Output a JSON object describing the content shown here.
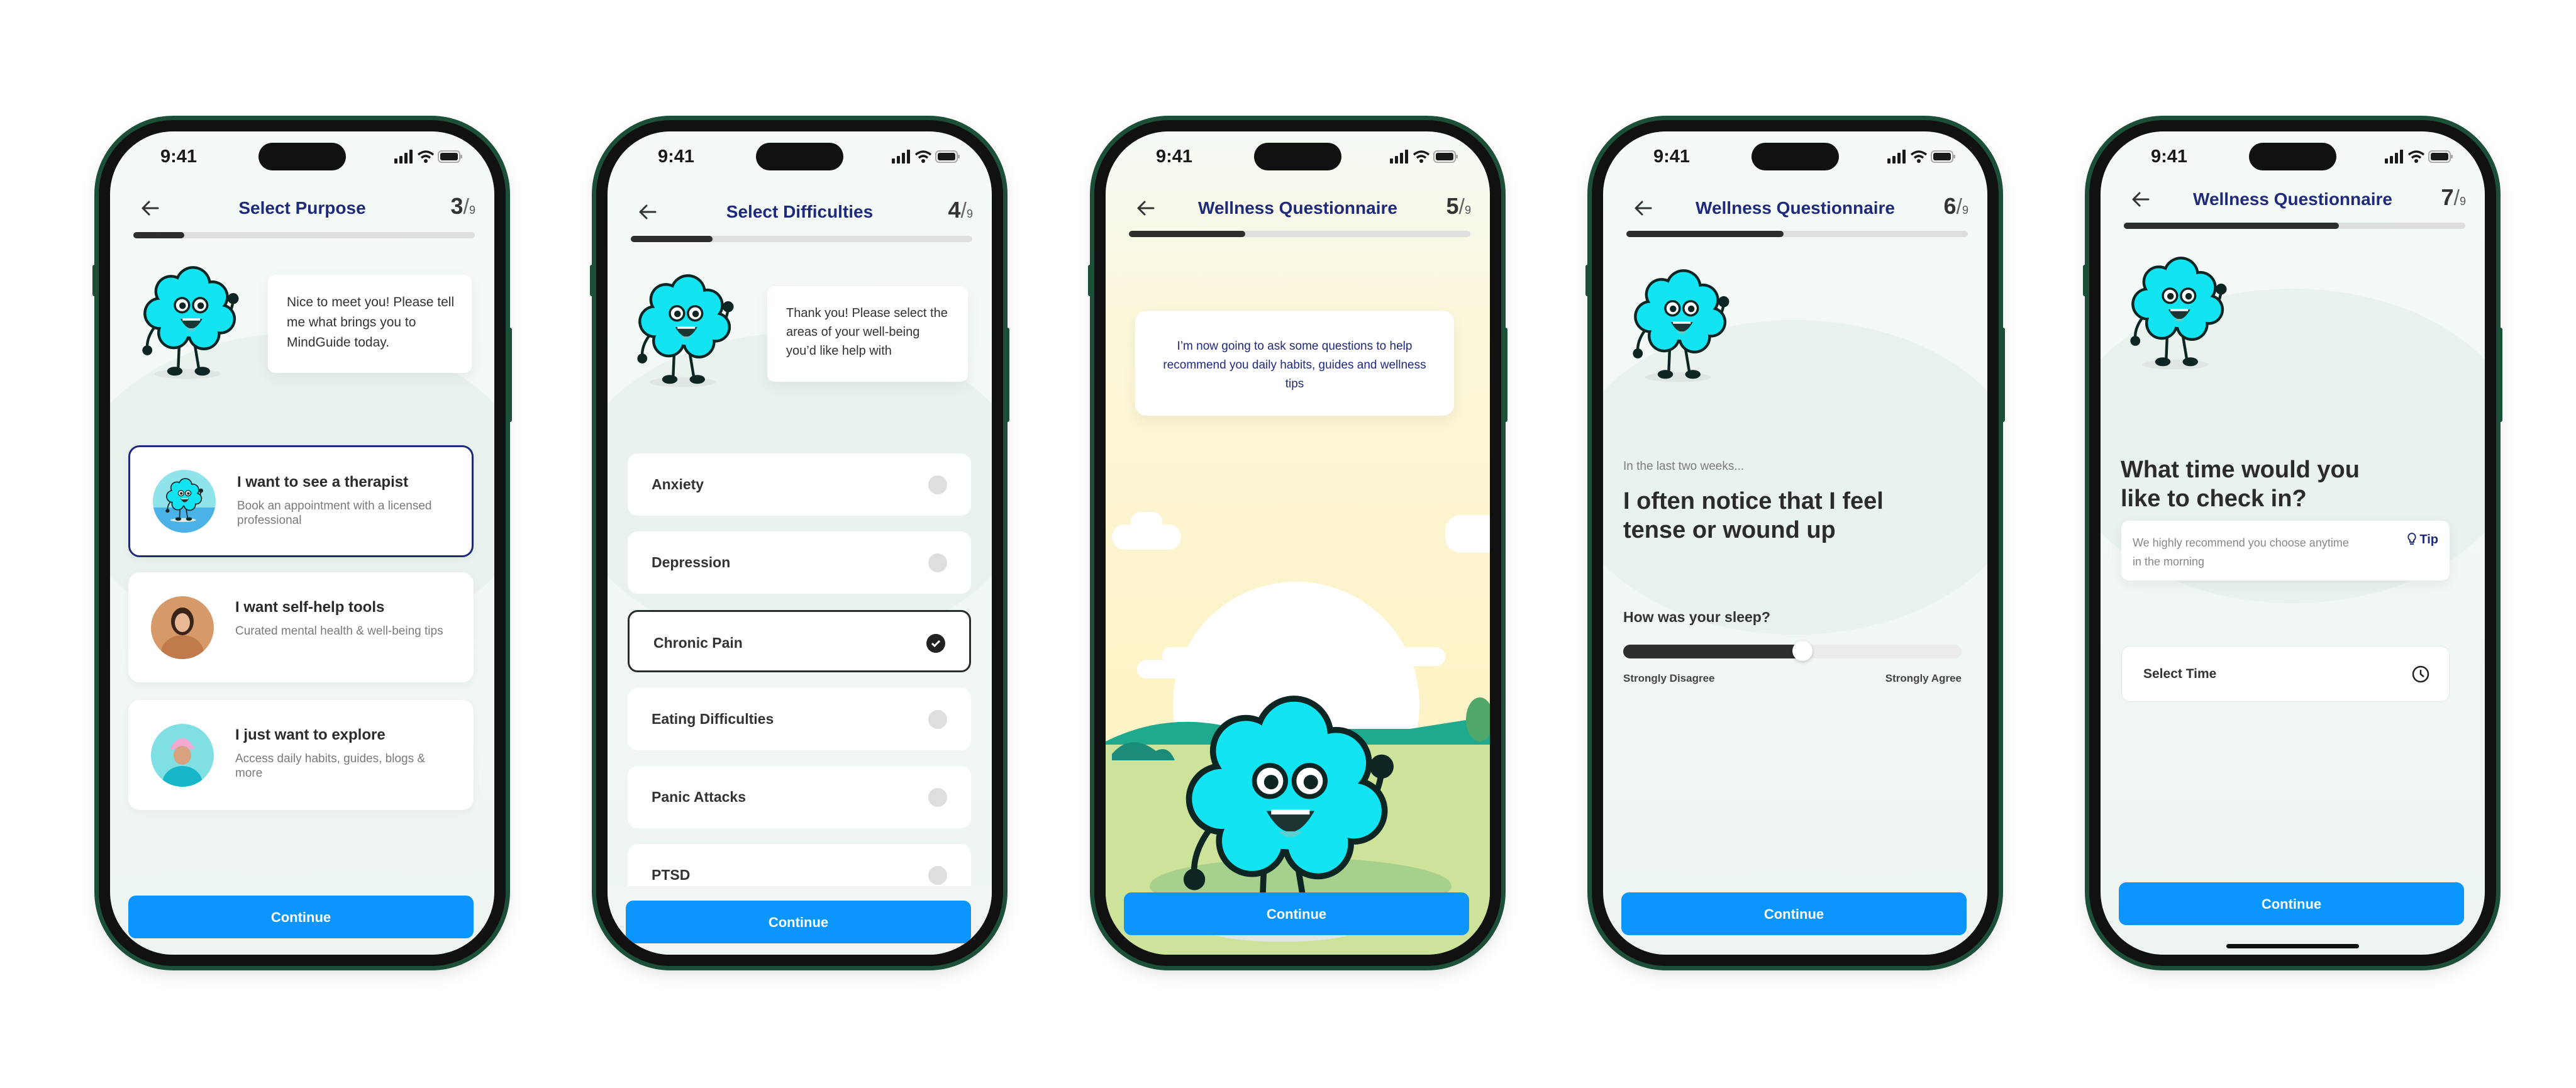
{
  "status_time": "9:41",
  "colors": {
    "primary": "#0a95ff",
    "title_navy": "#1f2a7a",
    "frame_green": "#1c4f37",
    "mascot_cyan": "#12e4f2"
  },
  "screens": [
    {
      "title": "Select Purpose",
      "step": "3",
      "total": "9",
      "progress": 0.15,
      "bubble": "Nice to meet you! Please tell me what brings you to MindGuide today.",
      "options": [
        {
          "title": "I want to see a therapist",
          "subtitle": "Book an appointment with a licensed professional",
          "selected": true
        },
        {
          "title": "I want self-help tools",
          "subtitle": "Curated mental health & well-being tips",
          "selected": false
        },
        {
          "title": "I just want to explore",
          "subtitle": "Access daily habits, guides, blogs & more",
          "selected": false
        }
      ],
      "continue": "Continue"
    },
    {
      "title": "Select Difficulties",
      "step": "4",
      "total": "9",
      "progress": 0.24,
      "bubble": "Thank you! Please select the areas of your well-being you’d like help with",
      "items": [
        {
          "label": "Anxiety",
          "checked": false
        },
        {
          "label": "Depression",
          "checked": false
        },
        {
          "label": "Chronic Pain",
          "checked": true
        },
        {
          "label": "Eating Difficulties",
          "checked": false
        },
        {
          "label": "Panic Attacks",
          "checked": false
        },
        {
          "label": "PTSD",
          "checked": false
        }
      ],
      "continue": "Continue"
    },
    {
      "title": "Wellness Questionnaire",
      "step": "5",
      "total": "9",
      "progress": 0.34,
      "bubble": "I’m now going to ask some questions to help recommend you daily habits, guides and wellness tips",
      "continue": "Continue"
    },
    {
      "title": "Wellness Questionnaire",
      "step": "6",
      "total": "9",
      "progress": 0.46,
      "prompt": "In the last two weeks...",
      "question": "I often notice that I feel tense or wound up",
      "slider": {
        "label": "How was your sleep?",
        "value": 0.53,
        "min_label": "Strongly Disagree",
        "max_label": "Strongly Agree"
      },
      "continue": "Continue"
    },
    {
      "title": "Wellness Questionnaire",
      "step": "7",
      "total": "9",
      "progress": 0.63,
      "question": "What time would you like to check in?",
      "tip": {
        "text": "We highly recommend you choose anytime in the morning",
        "label": "Tip"
      },
      "time_field": {
        "placeholder": "Select Time"
      },
      "continue": "Continue"
    }
  ]
}
